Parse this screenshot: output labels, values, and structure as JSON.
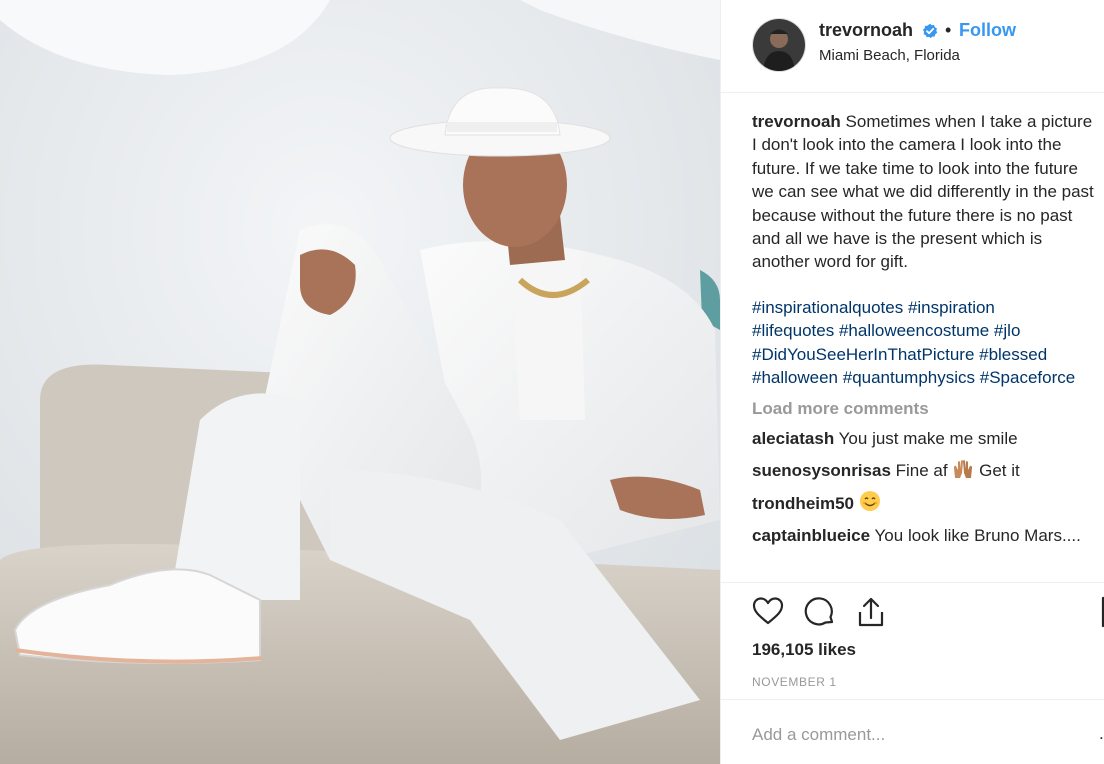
{
  "post": {
    "username": "trevornoah",
    "verified": true,
    "separator": "•",
    "follow_label": "Follow",
    "location": "Miami Beach, Florida",
    "caption": {
      "username": "trevornoah",
      "text": "Sometimes when I take a picture I don't look into the camera I look into the future. If we take time to look into the future we can see what we did differently in the past because without the future there is no past and all we have is the present which is another word for gift."
    },
    "hashtag_lines": [
      "#inspirationalquotes #inspiration",
      "#lifequotes #halloweencostume #jlo",
      "#DidYouSeeHerInThatPicture #blessed",
      "#halloween #quantumphysics #Spaceforce"
    ],
    "load_more_label": "Load more comments",
    "comments": [
      {
        "username": "aleciatash",
        "text": "You just make me smile",
        "emoji": ""
      },
      {
        "username": "suenosysonrisas",
        "text": "Fine af",
        "emoji": "raised-hands",
        "text_after": "Get it"
      },
      {
        "username": "trondheim50",
        "text": "",
        "emoji": "smiling-face"
      },
      {
        "username": "captainblueice",
        "text": "You look like Bruno Mars....",
        "emoji": ""
      }
    ],
    "likes": "196,105 likes",
    "date": "NOVEMBER 1",
    "add_comment_placeholder": "Add a comment...",
    "more_options": "..."
  },
  "icons": {
    "like": "heart-icon",
    "comment": "comment-icon",
    "share": "share-icon",
    "save": "bookmark-icon",
    "verified": "verified-badge-icon"
  },
  "colors": {
    "link": "#003569",
    "follow": "#3897f0",
    "muted": "#999999",
    "text": "#262626",
    "verified": "#3897f0"
  }
}
